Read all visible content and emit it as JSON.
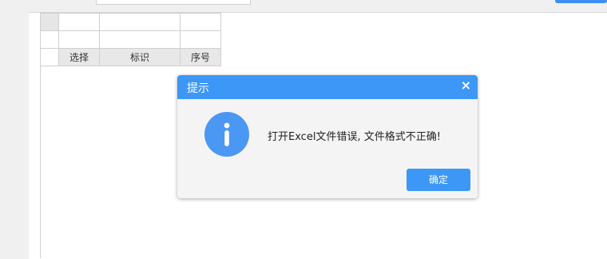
{
  "table": {
    "headers": [
      "选择",
      "标识",
      "序号"
    ]
  },
  "dialog": {
    "title": "提示",
    "close_glyph": "×",
    "message": "打开Excel文件错误, 文件格式不正确!",
    "ok_label": "确定",
    "icon": "info-icon",
    "header_color": "#3d97f6"
  }
}
